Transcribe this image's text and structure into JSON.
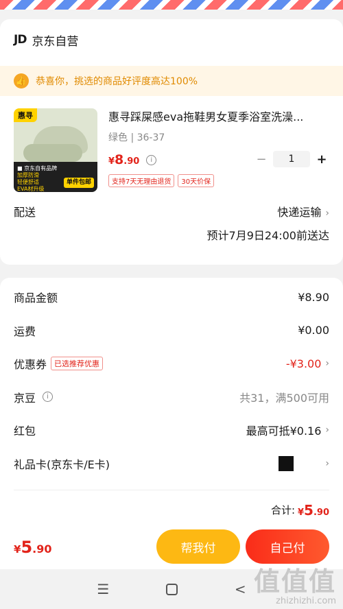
{
  "shop": {
    "logo": "JD",
    "name": "京东自营"
  },
  "banner": {
    "text": "恭喜你，挑选的商品好评度高达100%",
    "icon": "thumbs-up-icon"
  },
  "product": {
    "brand_badge": "惠寻",
    "strip_line1": "■ 京东自有品牌",
    "strip_features": [
      "加厚防滑",
      "轻便舒适",
      "EVA材升级"
    ],
    "strip_badge": "单件包邮",
    "title": "惠寻踩屎感eva拖鞋男女夏季浴室洗澡...",
    "spec": "绿色 | 36-37",
    "price_yen": "¥",
    "price_int": "8",
    "price_dec": ".90",
    "quantity": "1",
    "minus": "−",
    "plus": "+",
    "tags": [
      "支持7天无理由退货",
      "30天价保"
    ]
  },
  "shipping": {
    "label": "配送",
    "method": "快递运输",
    "date": "预计7月9日24:00前送达"
  },
  "summary": {
    "rows": [
      {
        "label": "商品金额",
        "value": "¥8.90"
      },
      {
        "label": "运费",
        "value": "¥0.00"
      },
      {
        "label": "优惠券",
        "tag": "已选推荐优惠",
        "value": "-¥3.00"
      },
      {
        "label": "京豆",
        "value": "共31，满500可用"
      },
      {
        "label": "红包",
        "value": "最高可抵¥0.16"
      },
      {
        "label": "礼品卡(京东卡/E卡)",
        "value": ""
      }
    ],
    "total_label": "合计:",
    "total_yen": "¥",
    "total_int": "5",
    "total_dec": ".90"
  },
  "bottom": {
    "price_yen": "¥",
    "price_int": "5",
    "price_dec": ".90",
    "help_pay": "帮我付",
    "self_pay": "自己付"
  },
  "nav": {
    "menu": "☰",
    "back": "<"
  },
  "watermark": {
    "big": "值值值",
    "small": "zhizhizhi.com"
  },
  "colors": {
    "accent": "#e2231a",
    "help_button": "#fdb813",
    "self_button": "#fa2c19"
  }
}
